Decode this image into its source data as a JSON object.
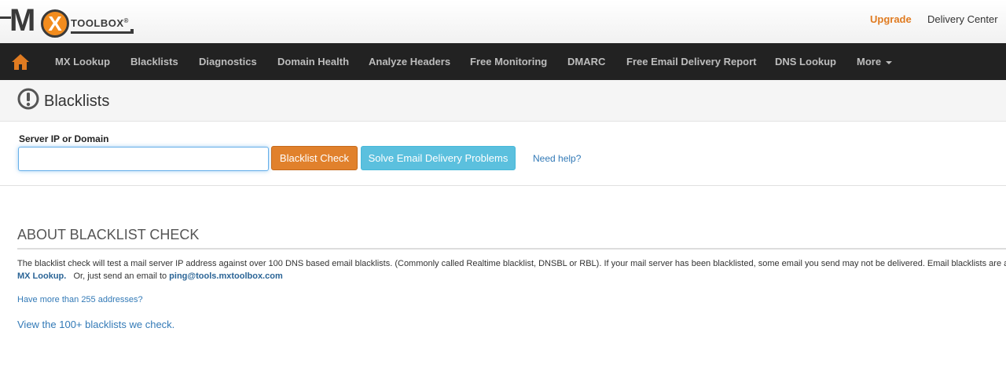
{
  "header": {
    "logo": {
      "mx": "M",
      "x": "X",
      "toolbox": "TOOLBOX",
      "reg": "®"
    },
    "links": {
      "upgrade": "Upgrade",
      "delivery_center": "Delivery Center"
    }
  },
  "nav": {
    "home_icon": "home-icon",
    "items": [
      "MX Lookup",
      "Blacklists",
      "Diagnostics",
      "Domain Health",
      "Analyze Headers",
      "Free Monitoring",
      "DMARC",
      "Free Email Delivery Report",
      "DNS Lookup",
      "More"
    ]
  },
  "page": {
    "title_icon": "exclamation-circle-icon",
    "title": "Blacklists"
  },
  "form": {
    "label": "Server IP or Domain",
    "input_value": "",
    "check_button": "Blacklist Check",
    "solve_button": "Solve Email Delivery Problems",
    "help_link": "Need help?"
  },
  "about": {
    "title": "ABOUT BLACKLIST CHECK",
    "paragraph": "The blacklist check will test a mail server IP address against over 100 DNS based email blacklists. (Commonly called Realtime blacklist, DNSBL or RBL).  If your mail server has been blacklisted, some email you send may not be delivered.  Email blacklists are a",
    "line2_link": "MX Lookup.",
    "line2_text": "   Or, just send an email to ",
    "line2_email": "ping@tools.mxtoolbox.com",
    "more_link": "Have more than 255 addresses?",
    "view_link": "View the 100+ blacklists we check."
  },
  "colors": {
    "accent_orange": "#e07b21",
    "nav_bg": "#222222",
    "link_blue": "#337ab7",
    "button_orange": "#e1812c",
    "button_cyan": "#5bc0de"
  }
}
